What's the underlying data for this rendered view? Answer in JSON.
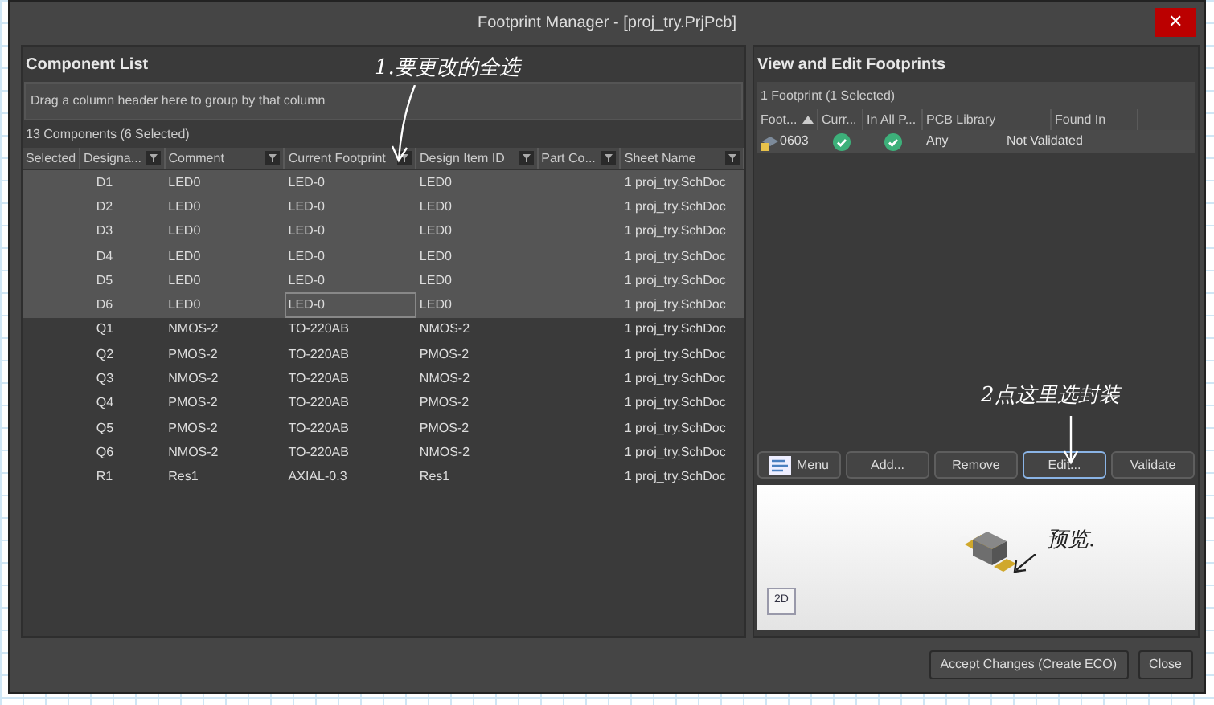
{
  "window": {
    "title": "Footprint Manager - [proj_try.PrjPcb]",
    "close_glyph": "✕"
  },
  "component_list": {
    "title": "Component List",
    "group_hint": "Drag a column header here to group by that column",
    "summary": "13 Components (6 Selected)",
    "columns": [
      {
        "label": "Selected",
        "filter": false
      },
      {
        "label": "Designa...",
        "filter": true
      },
      {
        "label": "Comment",
        "filter": true
      },
      {
        "label": "Current Footprint",
        "filter": true
      },
      {
        "label": "Design Item ID",
        "filter": true
      },
      {
        "label": "Part Co...",
        "filter": true
      },
      {
        "label": "Sheet Name",
        "filter": true
      }
    ],
    "rows": [
      {
        "selected": true,
        "focused": false,
        "designator": "D1",
        "comment": "LED0",
        "footprint": "LED-0",
        "item_id": "LED0",
        "sheet": "1 proj_try.SchDoc"
      },
      {
        "selected": true,
        "focused": false,
        "designator": "D2",
        "comment": "LED0",
        "footprint": "LED-0",
        "item_id": "LED0",
        "sheet": "1 proj_try.SchDoc"
      },
      {
        "selected": true,
        "focused": false,
        "designator": "D3",
        "comment": "LED0",
        "footprint": "LED-0",
        "item_id": "LED0",
        "sheet": "1 proj_try.SchDoc"
      },
      {
        "selected": true,
        "focused": false,
        "designator": "D4",
        "comment": "LED0",
        "footprint": "LED-0",
        "item_id": "LED0",
        "sheet": "1 proj_try.SchDoc"
      },
      {
        "selected": true,
        "focused": false,
        "designator": "D5",
        "comment": "LED0",
        "footprint": "LED-0",
        "item_id": "LED0",
        "sheet": "1 proj_try.SchDoc"
      },
      {
        "selected": true,
        "focused": true,
        "designator": "D6",
        "comment": "LED0",
        "footprint": "LED-0",
        "item_id": "LED0",
        "sheet": "1 proj_try.SchDoc"
      },
      {
        "selected": false,
        "focused": false,
        "designator": "Q1",
        "comment": "NMOS-2",
        "footprint": "TO-220AB",
        "item_id": "NMOS-2",
        "sheet": "1 proj_try.SchDoc"
      },
      {
        "selected": false,
        "focused": false,
        "designator": "Q2",
        "comment": "PMOS-2",
        "footprint": "TO-220AB",
        "item_id": "PMOS-2",
        "sheet": "1 proj_try.SchDoc"
      },
      {
        "selected": false,
        "focused": false,
        "designator": "Q3",
        "comment": "NMOS-2",
        "footprint": "TO-220AB",
        "item_id": "NMOS-2",
        "sheet": "1 proj_try.SchDoc"
      },
      {
        "selected": false,
        "focused": false,
        "designator": "Q4",
        "comment": "PMOS-2",
        "footprint": "TO-220AB",
        "item_id": "PMOS-2",
        "sheet": "1 proj_try.SchDoc"
      },
      {
        "selected": false,
        "focused": false,
        "designator": "Q5",
        "comment": "PMOS-2",
        "footprint": "TO-220AB",
        "item_id": "PMOS-2",
        "sheet": "1 proj_try.SchDoc"
      },
      {
        "selected": false,
        "focused": false,
        "designator": "Q6",
        "comment": "NMOS-2",
        "footprint": "TO-220AB",
        "item_id": "NMOS-2",
        "sheet": "1 proj_try.SchDoc"
      },
      {
        "selected": false,
        "focused": false,
        "designator": "R1",
        "comment": "Res1",
        "footprint": "AXIAL-0.3",
        "item_id": "Res1",
        "sheet": "1 proj_try.SchDoc"
      }
    ]
  },
  "footprints": {
    "title": "View and Edit Footprints",
    "summary": "1 Footprint (1 Selected)",
    "columns": [
      {
        "label": "Foot...",
        "sorted": true
      },
      {
        "label": "Curr...",
        "sorted": false
      },
      {
        "label": "In All P...",
        "sorted": false
      },
      {
        "label": "PCB Library",
        "sorted": false
      },
      {
        "label": "Found In",
        "sorted": false
      }
    ],
    "rows": [
      {
        "selected": true,
        "name": "0603",
        "current": true,
        "in_all_parts": true,
        "library": "Any",
        "found_in": "Not Validated"
      }
    ],
    "buttons": [
      {
        "label": "Menu",
        "kind": "menu",
        "focused": false
      },
      {
        "label": "Add...",
        "kind": "plain",
        "focused": false
      },
      {
        "label": "Remove",
        "kind": "plain",
        "focused": false
      },
      {
        "label": "Edit...",
        "kind": "plain",
        "focused": true
      },
      {
        "label": "Validate",
        "kind": "plain",
        "focused": false
      }
    ],
    "preview": {
      "view_button": "2D"
    }
  },
  "annotations": [
    "1.要更改的全选",
    "2点这里选封装",
    "预览."
  ],
  "footer_buttons": [
    "Accept Changes (Create ECO)",
    "Close"
  ]
}
